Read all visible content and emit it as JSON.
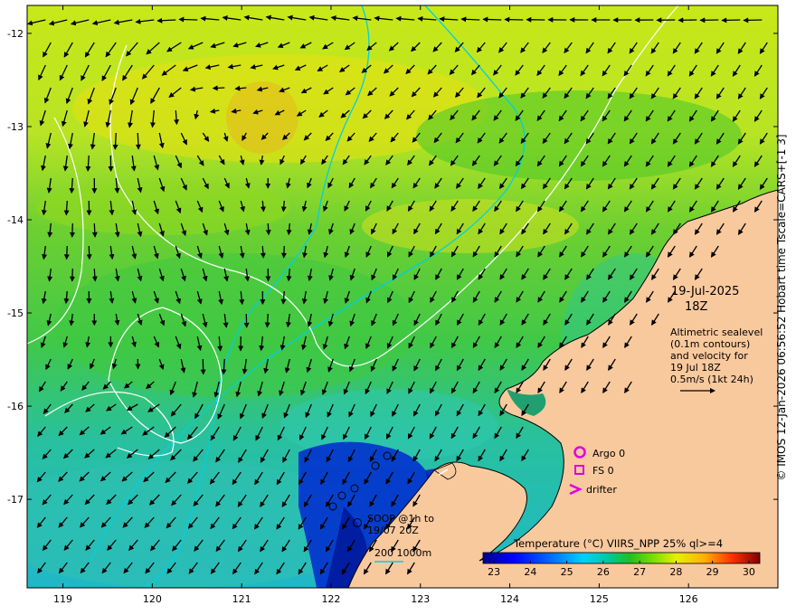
{
  "map": {
    "x_ticks": [
      "119",
      "120",
      "121",
      "122",
      "123",
      "124",
      "125",
      "126"
    ],
    "y_ticks": [
      "-12",
      "-13",
      "-14",
      "-15",
      "-16",
      "-17"
    ],
    "lon_range": [
      118.6,
      127.0
    ],
    "lat_range": [
      -17.95,
      -11.7
    ]
  },
  "annotation": {
    "date": "19-Jul-2025",
    "time": "18Z",
    "desc_lines": [
      "Altimetric sealevel",
      "(0.1m contours)",
      "and velocity for",
      "19 Jul 18Z",
      "0.5m/s (1kt 24h)"
    ]
  },
  "legend": {
    "argo": "Argo 0",
    "fs": "FS 0",
    "drifter": "drifter",
    "argo_color": "#e000e0"
  },
  "soop": {
    "lines": [
      "SOOP @1h to",
      "19/07 20Z"
    ]
  },
  "depth_legend": {
    "label": "200  1000m",
    "color": "#00c8d8"
  },
  "colorbar": {
    "title": "Temperature (°C) VIIRS_NPP 25% ql>=4",
    "ticks": [
      "23",
      "24",
      "25",
      "26",
      "27",
      "28",
      "29",
      "30"
    ],
    "vmin": 22.7,
    "vmax": 30.3
  },
  "credit": "© IMOS 12-Jan-2026 06:56:52 Hobart time Tscale=CARS+[-1 3]",
  "colors": {
    "land": "#f9c99e",
    "contour": "#ffffff",
    "isobath": "#00d0e0",
    "arrow": "#000000"
  }
}
